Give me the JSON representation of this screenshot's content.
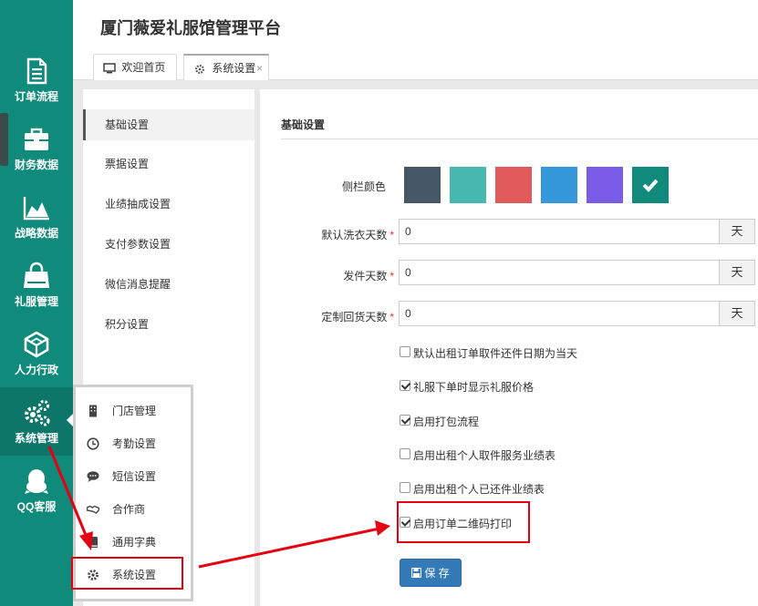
{
  "app": {
    "title": "厦门薇爱礼服馆管理平台"
  },
  "sidebar": {
    "items": [
      {
        "label": "订单流程",
        "icon": "document-icon"
      },
      {
        "label": "财务数据",
        "icon": "briefcase-icon"
      },
      {
        "label": "战略数据",
        "icon": "area-chart-icon"
      },
      {
        "label": "礼服管理",
        "icon": "shopping-bag-icon"
      },
      {
        "label": "人力行政",
        "icon": "cube-icon"
      },
      {
        "label": "系统管理",
        "icon": "gears-icon"
      },
      {
        "label": "QQ客服",
        "icon": "qq-icon"
      }
    ]
  },
  "tabs": [
    {
      "label": "欢迎首页",
      "icon": "monitor-icon"
    },
    {
      "label": "系统设置",
      "icon": "gear-icon",
      "close": "×"
    }
  ],
  "settings_menu": [
    {
      "label": "基础设置"
    },
    {
      "label": "票据设置"
    },
    {
      "label": "业绩抽成设置"
    },
    {
      "label": "支付参数设置"
    },
    {
      "label": "微信消息提醒"
    },
    {
      "label": "积分设置"
    }
  ],
  "form": {
    "section_title": "基础设置",
    "sidebar_color_label": "侧栏颜色",
    "colors": [
      "#465866",
      "#46b8af",
      "#e25b5b",
      "#3498db",
      "#7a5ce6",
      "#108a7a"
    ],
    "selected_color_index": 5,
    "required_mark": "*",
    "fields": [
      {
        "label": "默认洗衣天数",
        "value": "0",
        "unit": "天"
      },
      {
        "label": "发件天数",
        "value": "0",
        "unit": "天"
      },
      {
        "label": "定制回货天数",
        "value": "0",
        "unit": "天"
      }
    ],
    "checkboxes": [
      {
        "label": "默认出租订单取件还件日期为当天",
        "checked": false
      },
      {
        "label": "礼服下单时显示礼服价格",
        "checked": true
      },
      {
        "label": "启用打包流程",
        "checked": true
      },
      {
        "label": "启用出租个人取件服务业绩表",
        "checked": false
      },
      {
        "label": "启用出租个人已还件业绩表",
        "checked": false
      },
      {
        "label": "启用订单二维码打印",
        "checked": true
      }
    ],
    "save_label": "保 存"
  },
  "popup_menu": [
    {
      "label": "门店管理",
      "icon": "building-icon"
    },
    {
      "label": "考勤设置",
      "icon": "clock-icon"
    },
    {
      "label": "短信设置",
      "icon": "chat-icon"
    },
    {
      "label": "合作商",
      "icon": "handshake-icon"
    },
    {
      "label": "通用字典",
      "icon": "book-icon"
    },
    {
      "label": "系统设置",
      "icon": "gear-icon"
    }
  ],
  "colors": {
    "sidebar": "#108a7a",
    "annotation": "#e60012",
    "primary_button": "#337ab7"
  }
}
